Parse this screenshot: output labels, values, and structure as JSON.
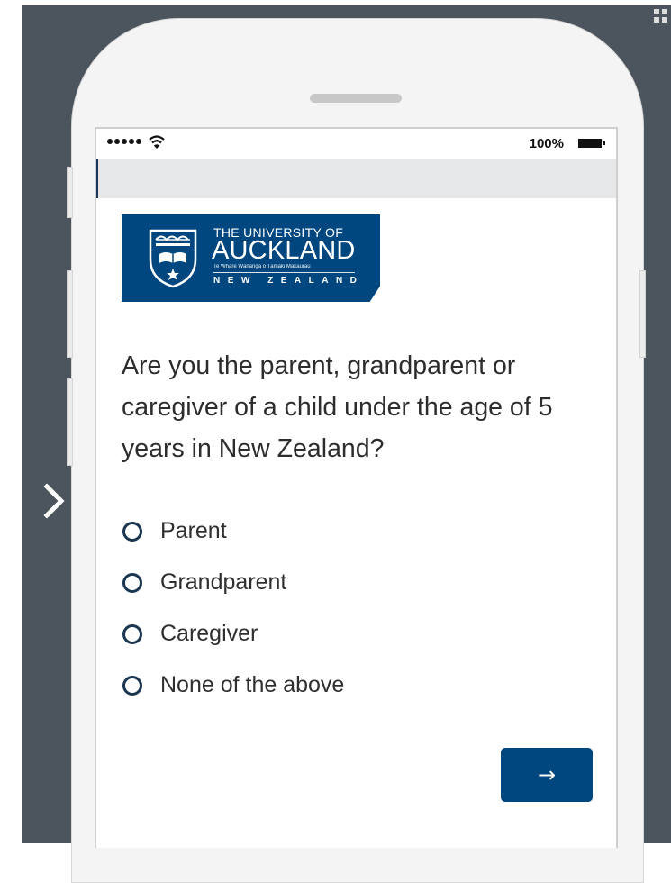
{
  "status_bar": {
    "battery_text": "100%"
  },
  "logo": {
    "line1": "THE UNIVERSITY OF",
    "line2": "AUCKLAND",
    "line3": "Te Whare Wānanga o Tāmaki Makaurau",
    "line4": "NEW ZEALAND"
  },
  "survey": {
    "question": "Are you the parent, grandparent or caregiver of a child under the age of 5 years in New Zealand?",
    "options": [
      {
        "label": "Parent"
      },
      {
        "label": "Grandparent"
      },
      {
        "label": "Caregiver"
      },
      {
        "label": "None of the above"
      }
    ],
    "next_label": "→"
  },
  "icons": {
    "left": "chevron-right-icon",
    "corner": "expand-icon",
    "wifi": "wifi-icon",
    "battery": "battery-icon",
    "crest": "university-crest-icon"
  },
  "colors": {
    "brand_blue": "#00467f",
    "stage_gray": "#4c555e",
    "radio_border": "#1a3650"
  }
}
